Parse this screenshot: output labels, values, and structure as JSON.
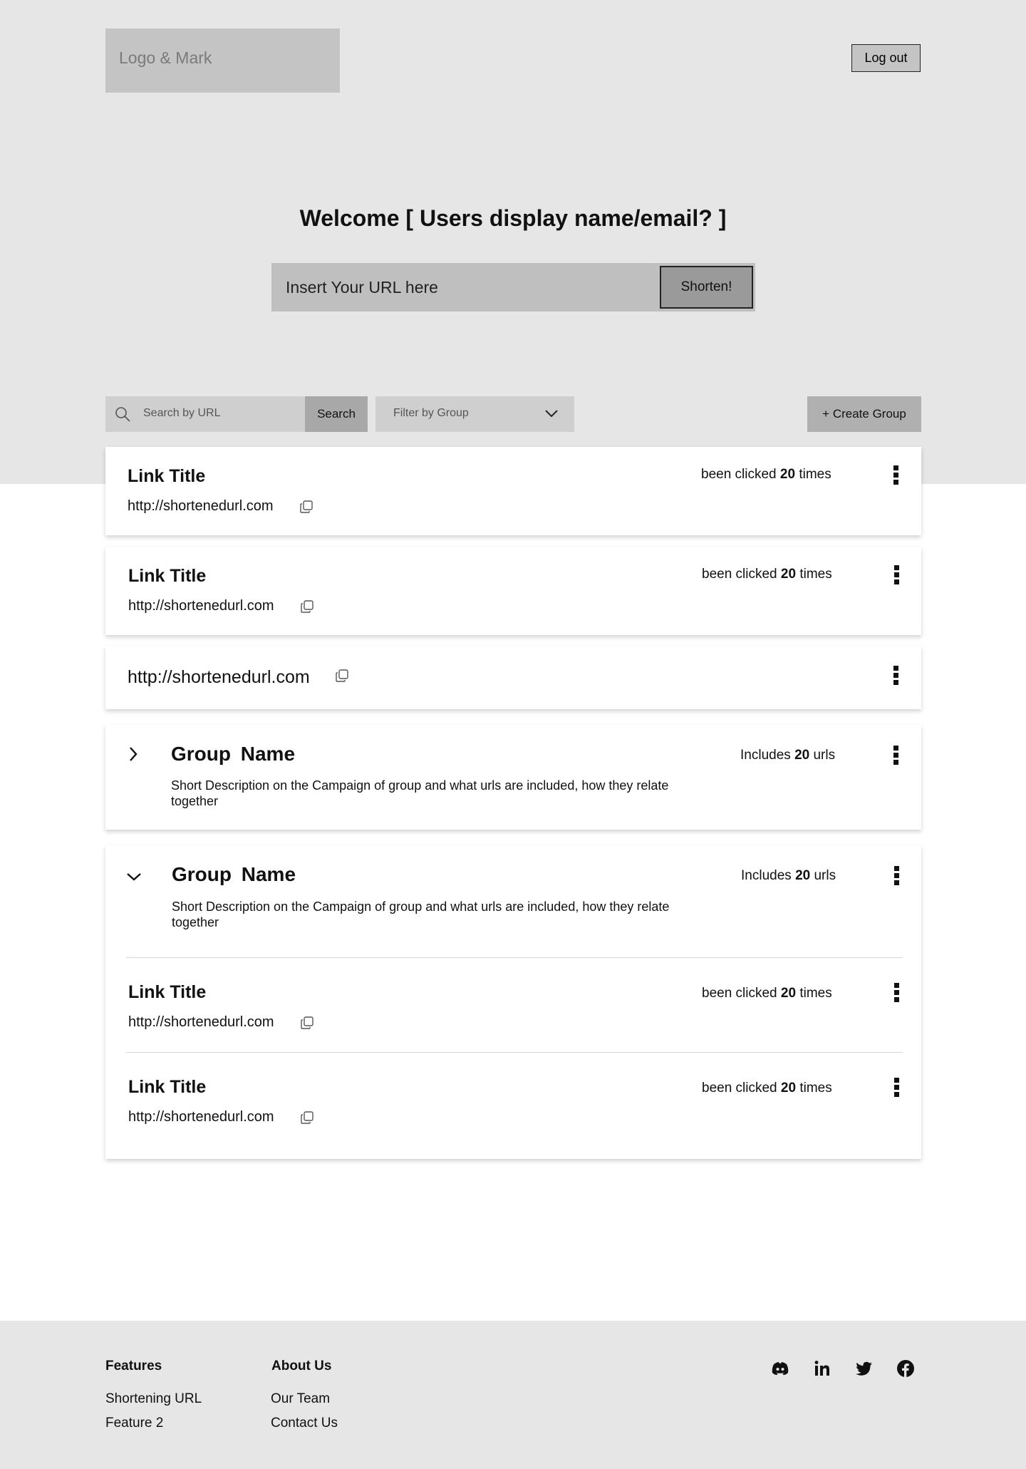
{
  "header": {
    "logo_text": "Logo & Mark",
    "logout_label": "Log out"
  },
  "hero": {
    "welcome": "Welcome [ Users display name/email? ]",
    "url_placeholder": "Insert Your URL here",
    "shorten_label": "Shorten!"
  },
  "toolbar": {
    "search_placeholder": "Search by URL",
    "search_label": "Search",
    "filter_label": "Filter by Group",
    "create_label": "+ Create Group"
  },
  "cards": [
    {
      "title": "Link Title",
      "url": "http://shortenedurl.com",
      "clicks_prefix": "been clicked",
      "clicks": "20",
      "clicks_suffix": "times"
    },
    {
      "title": "Link Title",
      "url": "http://shortenedurl.com",
      "clicks_prefix": "been clicked",
      "clicks": "20",
      "clicks_suffix": "times"
    },
    {
      "url": "http://shortenedurl.com"
    }
  ],
  "groups": [
    {
      "name": "Group  Name",
      "description": "Short Description on the Campaign of group and what urls are included, how they relate together",
      "includes_prefix": "Includes",
      "count": "20",
      "includes_suffix": "urls",
      "expanded": false
    },
    {
      "name": "Group  Name",
      "description": "Short Description on the Campaign of group and what urls are included, how they relate together",
      "includes_prefix": "Includes",
      "count": "20",
      "includes_suffix": "urls",
      "expanded": true,
      "links": [
        {
          "title": "Link Title",
          "url": "http://shortenedurl.com",
          "clicks_prefix": "been clicked",
          "clicks": "20",
          "clicks_suffix": "times"
        },
        {
          "title": "Link Title",
          "url": "http://shortenedurl.com",
          "clicks_prefix": "been clicked",
          "clicks": "20",
          "clicks_suffix": "times"
        }
      ]
    }
  ],
  "footer": {
    "features_heading": "Features",
    "features": [
      "Shortening URL",
      "Feature 2"
    ],
    "about_heading": "About Us",
    "about": [
      "Our Team",
      "Contact Us"
    ],
    "social_icons": [
      "discord-icon",
      "linkedin-icon",
      "twitter-icon",
      "facebook-icon"
    ]
  },
  "colors": {
    "hero_bg": "#e6e6e6",
    "placeholder_box": "#c4c4c4",
    "shorten_button": "#9a9a9a",
    "create_button": "#b0b0b0"
  }
}
